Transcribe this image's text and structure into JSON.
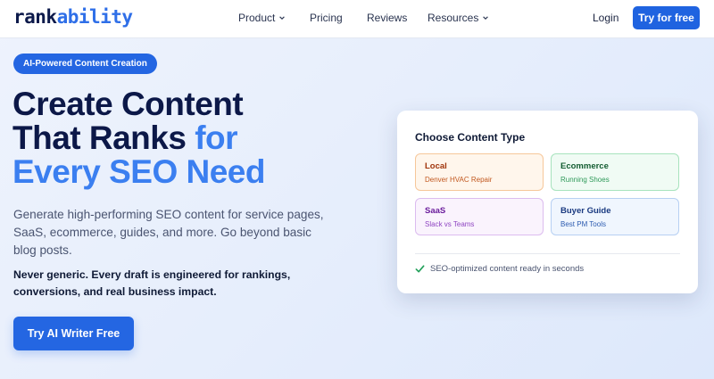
{
  "header": {
    "logo_part1": "rank",
    "logo_part2": "ability",
    "nav": [
      {
        "label": "Product",
        "has_dropdown": true
      },
      {
        "label": "Pricing",
        "has_dropdown": false
      },
      {
        "label": "Reviews",
        "has_dropdown": false
      },
      {
        "label": "Resources",
        "has_dropdown": true
      }
    ],
    "login_label": "Login",
    "cta_label": "Try for free"
  },
  "hero": {
    "badge": "AI-Powered Content Creation",
    "headline_line1": "Create Content",
    "headline_line2_dark": "That Ranks ",
    "headline_line2_blue": "for",
    "headline_line3": "Every SEO Need",
    "subtext": "Generate high-performing SEO content for service pages, SaaS, ecommerce, guides, and more. Go beyond basic blog posts.",
    "bold_text": "Never generic. Every draft is engineered for rankings, conversions, and real business impact.",
    "cta_label": "Try AI Writer Free"
  },
  "card": {
    "title": "Choose Content Type",
    "options": [
      {
        "title": "Local",
        "subtitle": "Denver HVAC Repair"
      },
      {
        "title": "Ecommerce",
        "subtitle": "Running Shoes"
      },
      {
        "title": "SaaS",
        "subtitle": "Slack vs Teams"
      },
      {
        "title": "Buyer Guide",
        "subtitle": "Best PM Tools"
      }
    ],
    "ready_text": "SEO-optimized content ready in seconds",
    "ready_icon": "check-icon"
  },
  "colors": {
    "brand": "#1f63e0",
    "heading": "#0c1848",
    "accent_blue": "#3b7ff0",
    "check_green": "#22a05a"
  }
}
